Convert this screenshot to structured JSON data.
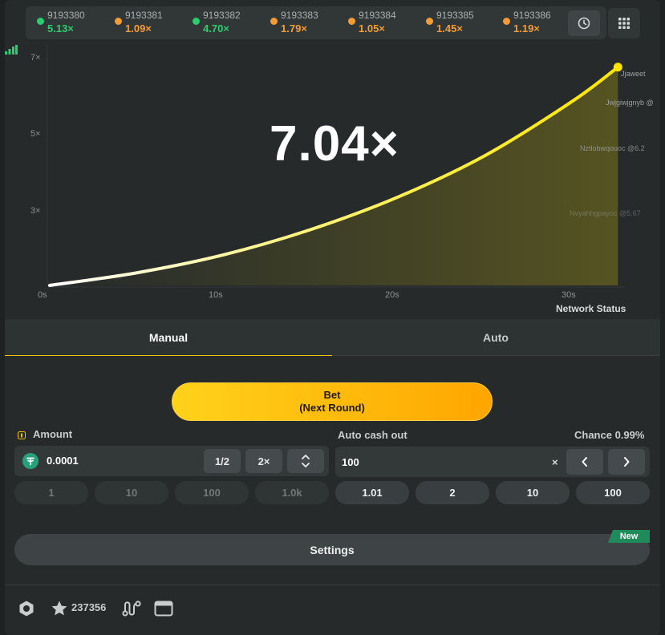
{
  "history": [
    {
      "id": "9193380",
      "mult": "5.13×",
      "color": "#2ecc71"
    },
    {
      "id": "9193381",
      "mult": "1.09×",
      "color": "#f39c35"
    },
    {
      "id": "9193382",
      "mult": "4.70×",
      "color": "#2ecc71"
    },
    {
      "id": "9193383",
      "mult": "1.79×",
      "color": "#f39c35"
    },
    {
      "id": "9193384",
      "mult": "1.05×",
      "color": "#f39c35"
    },
    {
      "id": "9193385",
      "mult": "1.45×",
      "color": "#f39c35"
    },
    {
      "id": "9193386",
      "mult": "1.19×",
      "color": "#f39c35"
    }
  ],
  "history_icons": {
    "clock": "clock-icon",
    "grid": "grid-icon"
  },
  "chart_data": {
    "type": "line",
    "current_multiplier": "7.04×",
    "y_ticks": [
      "7×",
      "5×",
      "3×"
    ],
    "x_ticks": [
      "0s",
      "10s",
      "20s",
      "30s"
    ],
    "xlim": [
      0,
      33
    ],
    "ylim": [
      1,
      7.3
    ],
    "curve": {
      "x": [
        0,
        5,
        10,
        15,
        20,
        25,
        30,
        32.6
      ],
      "y": [
        1.0,
        1.35,
        1.85,
        2.55,
        3.45,
        4.6,
        6.1,
        7.04
      ]
    },
    "line_color": "#ffe600",
    "players": [
      {
        "label": "Jjaweet",
        "y": 6.97
      },
      {
        "label": "Jwjgiwjgnyb @",
        "y": 6.5
      },
      {
        "label": "Nztlobwqouoc @6.2",
        "y": 5.6
      },
      {
        "label": "Nvyahhgpayoc @5.67",
        "y": 3.9
      }
    ]
  },
  "network_status": "Network Status",
  "tabs": {
    "manual": "Manual",
    "auto": "Auto"
  },
  "bet_button": {
    "line1": "Bet",
    "line2": "(Next Round)"
  },
  "amount": {
    "label": "Amount",
    "value": "0.0001",
    "half": "1/2",
    "double": "2×",
    "quick": [
      "1",
      "10",
      "100",
      "1.0k"
    ]
  },
  "cashout": {
    "label": "Auto cash out",
    "chance": "Chance 0.99%",
    "value": "100",
    "suffix": "×",
    "quick": [
      "1.01",
      "2",
      "10",
      "100"
    ]
  },
  "settings": {
    "label": "Settings",
    "badge": "New"
  },
  "footer": {
    "favorites_count": "237356"
  },
  "colors": {
    "accent": "#ffc300",
    "win": "#2ecc71",
    "loss": "#f39c35"
  }
}
